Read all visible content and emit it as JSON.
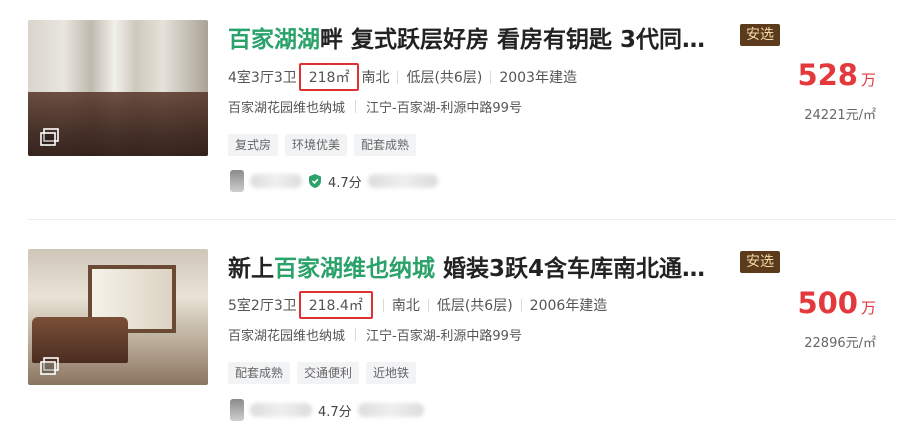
{
  "listings": [
    {
      "title_highlight": "百家湖湖",
      "title_rest": "畔 复式跃层好房 看房有钥匙 3代同…",
      "badge": "安选",
      "layout": "4室3厅3卫",
      "area": "218㎡",
      "orientation": "南北",
      "floor": "低层(共6层)",
      "year": "2003年建造",
      "community": "百家湖花园维也纳城",
      "location": "江宁-百家湖-利源中路99号",
      "tags": [
        "复式房",
        "环境优美",
        "配套成熟"
      ],
      "score": "4.7分",
      "price": "528",
      "price_unit": "万",
      "unit_price": "24221元/㎡"
    },
    {
      "title_prefix": "新上",
      "title_highlight": "百家湖维也纳城",
      "title_rest": " 婚装3跃4含车库南北通…",
      "badge": "安选",
      "layout": "5室2厅3卫",
      "area": "218.4㎡",
      "orientation": "南北",
      "floor": "低层(共6层)",
      "year": "2006年建造",
      "community": "百家湖花园维也纳城",
      "location": "江宁-百家湖-利源中路99号",
      "tags": [
        "配套成熟",
        "交通便利",
        "近地铁"
      ],
      "score": "4.7分",
      "price": "500",
      "price_unit": "万",
      "unit_price": "22896元/㎡"
    }
  ],
  "colors": {
    "highlight": "#2aa26a",
    "price": "#e4393c",
    "badge_bg": "#5b3b1c",
    "area_box": "#e03131"
  }
}
